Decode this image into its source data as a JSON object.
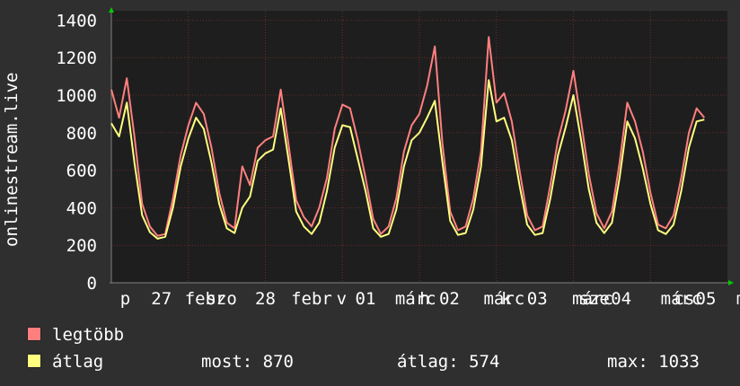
{
  "chart_data": {
    "type": "line",
    "ylabel": "onlinestream.live",
    "ylim": [
      0,
      1450
    ],
    "yticks": [
      0,
      200,
      400,
      600,
      800,
      1000,
      1200,
      1400
    ],
    "xlim": [
      0,
      8
    ],
    "grid": true,
    "x_tick_labels": [
      {
        "x": 0.18,
        "label": "p"
      },
      {
        "x": 0.65,
        "label": "27"
      },
      {
        "x": 1.22,
        "label": "febr"
      },
      {
        "x": 1.43,
        "label": "szo"
      },
      {
        "x": 2.0,
        "label": "28"
      },
      {
        "x": 2.6,
        "label": "febr"
      },
      {
        "x": 2.99,
        "label": "v"
      },
      {
        "x": 3.3,
        "label": "01"
      },
      {
        "x": 3.95,
        "label": "márc"
      },
      {
        "x": 4.07,
        "label": "h"
      },
      {
        "x": 4.39,
        "label": "02"
      },
      {
        "x": 5.1,
        "label": "márc"
      },
      {
        "x": 5.13,
        "label": "k"
      },
      {
        "x": 5.53,
        "label": "03"
      },
      {
        "x": 6.25,
        "label": "márc"
      },
      {
        "x": 6.27,
        "label": "sze"
      },
      {
        "x": 6.62,
        "label": "04"
      },
      {
        "x": 7.4,
        "label": "márc"
      },
      {
        "x": 7.44,
        "label": "cs"
      },
      {
        "x": 7.72,
        "label": "05"
      },
      {
        "x": 8.18,
        "label": "m"
      }
    ],
    "series": [
      {
        "name": "legtöbb",
        "color": "#ff7f7f",
        "points": [
          [
            0,
            1030
          ],
          [
            0.1,
            880
          ],
          [
            0.2,
            1090
          ],
          [
            0.3,
            780
          ],
          [
            0.4,
            420
          ],
          [
            0.5,
            300
          ],
          [
            0.6,
            250
          ],
          [
            0.7,
            260
          ],
          [
            0.8,
            450
          ],
          [
            0.9,
            680
          ],
          [
            1.0,
            840
          ],
          [
            1.1,
            960
          ],
          [
            1.2,
            900
          ],
          [
            1.3,
            720
          ],
          [
            1.4,
            480
          ],
          [
            1.5,
            320
          ],
          [
            1.6,
            290
          ],
          [
            1.7,
            620
          ],
          [
            1.8,
            520
          ],
          [
            1.9,
            720
          ],
          [
            2.0,
            760
          ],
          [
            2.1,
            780
          ],
          [
            2.2,
            1030
          ],
          [
            2.3,
            740
          ],
          [
            2.4,
            440
          ],
          [
            2.5,
            350
          ],
          [
            2.6,
            300
          ],
          [
            2.7,
            400
          ],
          [
            2.8,
            560
          ],
          [
            2.9,
            820
          ],
          [
            3.0,
            950
          ],
          [
            3.1,
            930
          ],
          [
            3.2,
            760
          ],
          [
            3.3,
            560
          ],
          [
            3.4,
            340
          ],
          [
            3.5,
            260
          ],
          [
            3.6,
            300
          ],
          [
            3.7,
            450
          ],
          [
            3.8,
            700
          ],
          [
            3.9,
            840
          ],
          [
            4.0,
            900
          ],
          [
            4.1,
            1050
          ],
          [
            4.2,
            1260
          ],
          [
            4.3,
            740
          ],
          [
            4.4,
            380
          ],
          [
            4.5,
            280
          ],
          [
            4.6,
            300
          ],
          [
            4.7,
            450
          ],
          [
            4.8,
            700
          ],
          [
            4.9,
            1310
          ],
          [
            5.0,
            960
          ],
          [
            5.1,
            1010
          ],
          [
            5.2,
            860
          ],
          [
            5.3,
            600
          ],
          [
            5.4,
            360
          ],
          [
            5.5,
            280
          ],
          [
            5.6,
            300
          ],
          [
            5.7,
            520
          ],
          [
            5.8,
            760
          ],
          [
            5.9,
            920
          ],
          [
            6.0,
            1130
          ],
          [
            6.1,
            860
          ],
          [
            6.2,
            580
          ],
          [
            6.3,
            370
          ],
          [
            6.4,
            290
          ],
          [
            6.5,
            380
          ],
          [
            6.6,
            640
          ],
          [
            6.7,
            960
          ],
          [
            6.8,
            860
          ],
          [
            6.9,
            700
          ],
          [
            7.0,
            480
          ],
          [
            7.1,
            310
          ],
          [
            7.2,
            290
          ],
          [
            7.3,
            360
          ],
          [
            7.4,
            560
          ],
          [
            7.5,
            800
          ],
          [
            7.6,
            930
          ],
          [
            7.7,
            880
          ]
        ]
      },
      {
        "name": "átlag",
        "color": "#ffff7f",
        "points": [
          [
            0,
            850
          ],
          [
            0.1,
            780
          ],
          [
            0.2,
            960
          ],
          [
            0.3,
            640
          ],
          [
            0.4,
            360
          ],
          [
            0.5,
            270
          ],
          [
            0.6,
            235
          ],
          [
            0.7,
            245
          ],
          [
            0.8,
            400
          ],
          [
            0.9,
            620
          ],
          [
            1.0,
            770
          ],
          [
            1.1,
            880
          ],
          [
            1.2,
            820
          ],
          [
            1.3,
            640
          ],
          [
            1.4,
            420
          ],
          [
            1.5,
            290
          ],
          [
            1.6,
            265
          ],
          [
            1.7,
            400
          ],
          [
            1.8,
            460
          ],
          [
            1.9,
            650
          ],
          [
            2.0,
            690
          ],
          [
            2.1,
            710
          ],
          [
            2.2,
            930
          ],
          [
            2.3,
            660
          ],
          [
            2.4,
            380
          ],
          [
            2.5,
            300
          ],
          [
            2.6,
            260
          ],
          [
            2.7,
            320
          ],
          [
            2.8,
            490
          ],
          [
            2.9,
            720
          ],
          [
            3.0,
            840
          ],
          [
            3.1,
            830
          ],
          [
            3.2,
            660
          ],
          [
            3.3,
            490
          ],
          [
            3.4,
            290
          ],
          [
            3.5,
            245
          ],
          [
            3.6,
            260
          ],
          [
            3.7,
            390
          ],
          [
            3.8,
            620
          ],
          [
            3.9,
            760
          ],
          [
            4.0,
            800
          ],
          [
            4.1,
            880
          ],
          [
            4.2,
            970
          ],
          [
            4.3,
            640
          ],
          [
            4.4,
            330
          ],
          [
            4.5,
            255
          ],
          [
            4.6,
            265
          ],
          [
            4.7,
            390
          ],
          [
            4.8,
            620
          ],
          [
            4.9,
            1080
          ],
          [
            5.0,
            860
          ],
          [
            5.1,
            880
          ],
          [
            5.2,
            760
          ],
          [
            5.3,
            520
          ],
          [
            5.4,
            310
          ],
          [
            5.5,
            255
          ],
          [
            5.6,
            265
          ],
          [
            5.7,
            450
          ],
          [
            5.8,
            680
          ],
          [
            5.9,
            830
          ],
          [
            6.0,
            1000
          ],
          [
            6.1,
            760
          ],
          [
            6.2,
            500
          ],
          [
            6.3,
            320
          ],
          [
            6.4,
            265
          ],
          [
            6.5,
            320
          ],
          [
            6.6,
            560
          ],
          [
            6.7,
            860
          ],
          [
            6.8,
            770
          ],
          [
            6.9,
            610
          ],
          [
            7.0,
            420
          ],
          [
            7.1,
            280
          ],
          [
            7.2,
            260
          ],
          [
            7.3,
            310
          ],
          [
            7.4,
            490
          ],
          [
            7.5,
            720
          ],
          [
            7.6,
            860
          ],
          [
            7.7,
            870
          ]
        ]
      }
    ]
  },
  "legend": {
    "items": [
      {
        "label": "legtöbb",
        "color": "#ff7f7f"
      },
      {
        "label": "átlag",
        "color": "#ffff7f"
      }
    ]
  },
  "stats": {
    "most": "most: 870",
    "atlag": "átlag: 574",
    "max": "max: 1033"
  }
}
